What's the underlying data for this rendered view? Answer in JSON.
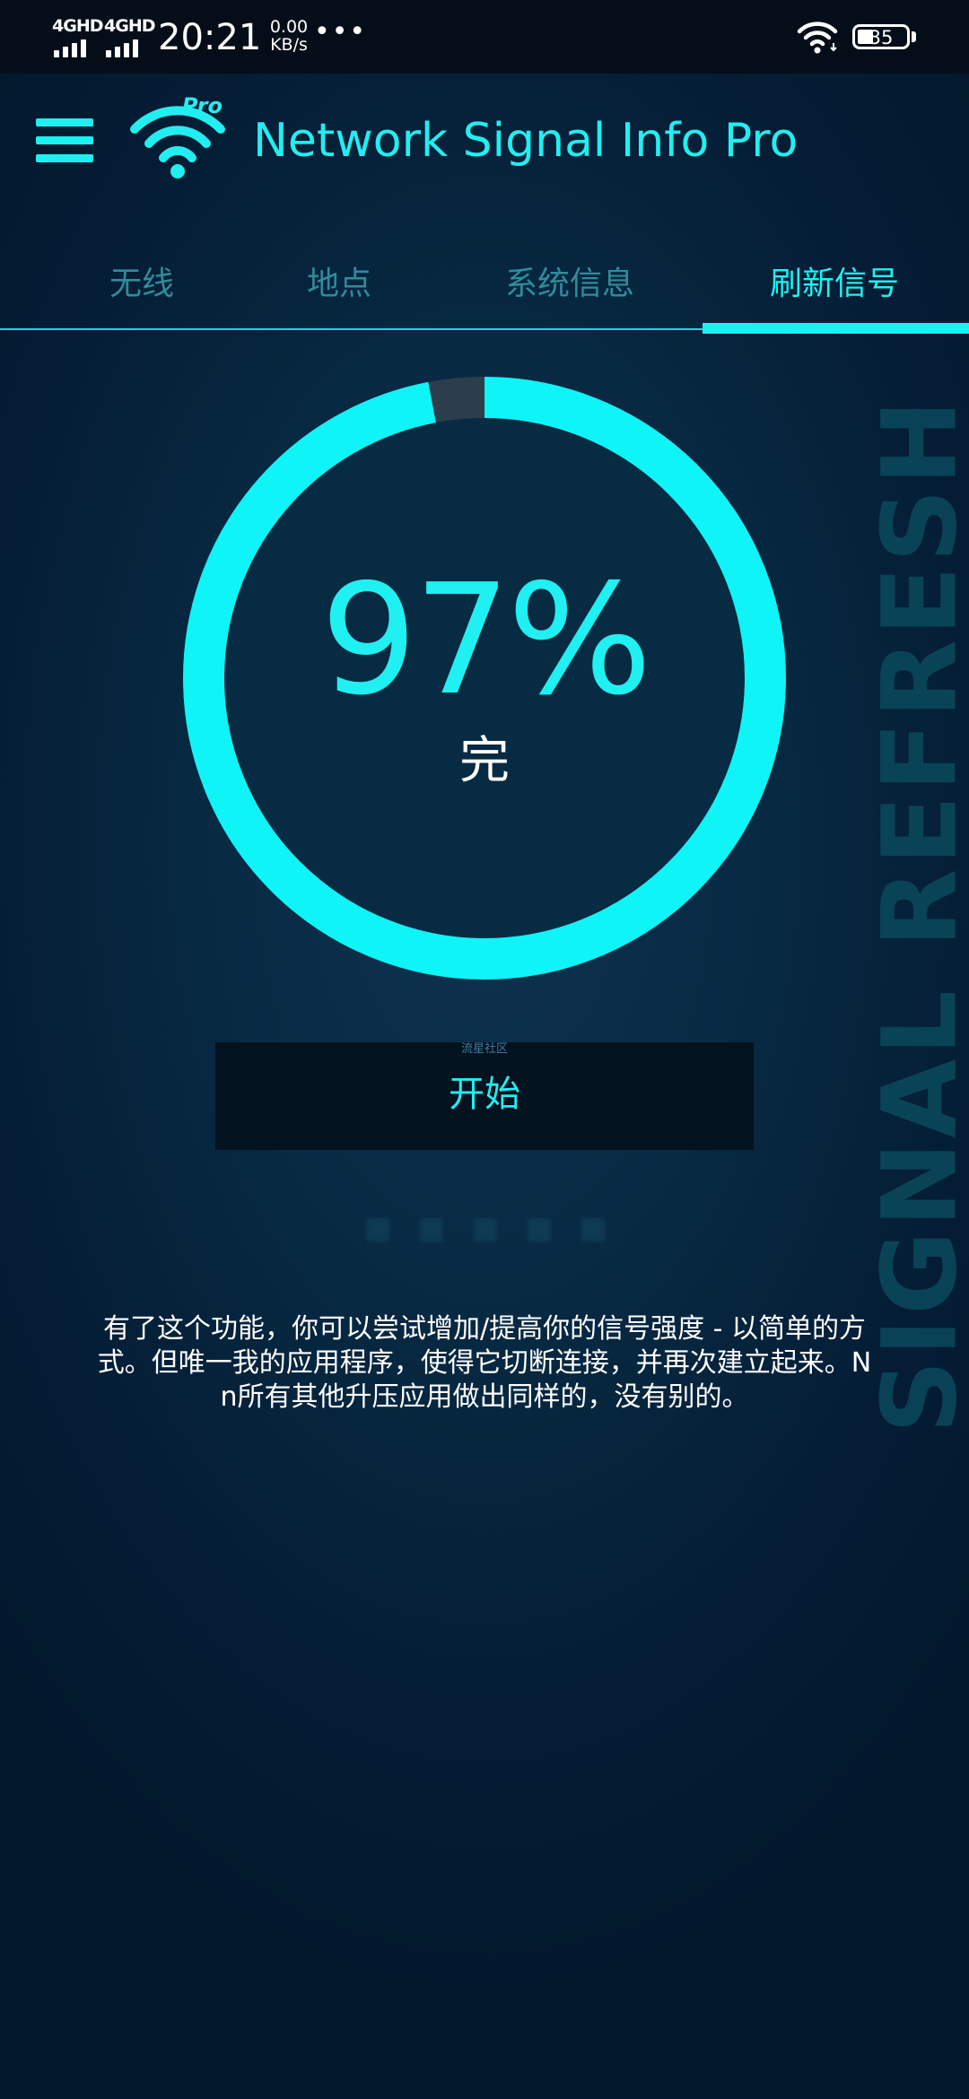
{
  "status_bar": {
    "network_1": "4GHD",
    "network_2": "4GHD",
    "time": "20:21",
    "speed_value": "0.00",
    "speed_unit": "KB/s",
    "more": "•••",
    "battery": "35"
  },
  "header": {
    "title": "Network Signal Info Pro",
    "logo_badge": "Pro"
  },
  "tabs": [
    {
      "label": "无线"
    },
    {
      "label": "地点"
    },
    {
      "label": "系统信息"
    },
    {
      "label": "刷新信号"
    }
  ],
  "active_tab": "刷新信号",
  "watermark": "SIGNAL REFRESH",
  "gauge": {
    "progress": 0.97,
    "value": "97%",
    "status": "完"
  },
  "start": {
    "tag": "流星社区",
    "label": "开始"
  },
  "description": "有了这个功能，你可以尝试增加/提高你的信号强度 - 以简单的方式。但唯一我的应用程序，使得它切断连接，并再次建立起来。N n所有其他升压应用做出同样的，没有别的。",
  "colors": {
    "accent": "#22eef0",
    "tab_inactive": "#2f8c9b",
    "background": "#041d35",
    "status_bar": "#050e18"
  }
}
